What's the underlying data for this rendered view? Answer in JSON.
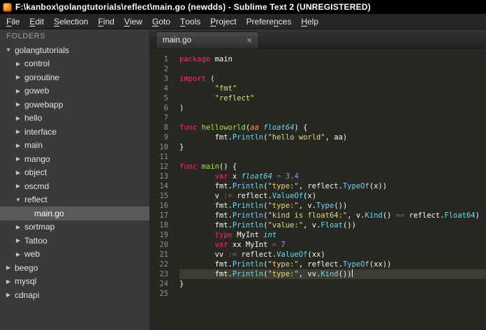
{
  "window": {
    "title": "F:\\kanbox\\golangtutorials\\reflect\\main.go (newdds) - Sublime Text 2 (UNREGISTERED)"
  },
  "menu": {
    "items": [
      {
        "pre": "",
        "key": "F",
        "post": "ile"
      },
      {
        "pre": "",
        "key": "E",
        "post": "dit"
      },
      {
        "pre": "",
        "key": "S",
        "post": "election"
      },
      {
        "pre": "",
        "key": "F",
        "post": "ind"
      },
      {
        "pre": "",
        "key": "V",
        "post": "iew"
      },
      {
        "pre": "",
        "key": "G",
        "post": "oto"
      },
      {
        "pre": "",
        "key": "T",
        "post": "ools"
      },
      {
        "pre": "",
        "key": "P",
        "post": "roject"
      },
      {
        "pre": "Prefere",
        "key": "n",
        "post": "ces"
      },
      {
        "pre": "",
        "key": "H",
        "post": "elp"
      }
    ]
  },
  "sidebar": {
    "header": "FOLDERS",
    "icons": {
      "collapsed": "▶",
      "expanded": "▼"
    },
    "items": [
      {
        "label": "golangtutorials",
        "level": 0,
        "kind": "expanded",
        "selected": false
      },
      {
        "label": "control",
        "level": 1,
        "kind": "collapsed",
        "selected": false
      },
      {
        "label": "goroutine",
        "level": 1,
        "kind": "collapsed",
        "selected": false
      },
      {
        "label": "goweb",
        "level": 1,
        "kind": "collapsed",
        "selected": false
      },
      {
        "label": "gowebapp",
        "level": 1,
        "kind": "collapsed",
        "selected": false
      },
      {
        "label": "hello",
        "level": 1,
        "kind": "collapsed",
        "selected": false
      },
      {
        "label": "interface",
        "level": 1,
        "kind": "collapsed",
        "selected": false
      },
      {
        "label": "main",
        "level": 1,
        "kind": "collapsed",
        "selected": false
      },
      {
        "label": "mango",
        "level": 1,
        "kind": "collapsed",
        "selected": false
      },
      {
        "label": "object",
        "level": 1,
        "kind": "collapsed",
        "selected": false
      },
      {
        "label": "oscmd",
        "level": 1,
        "kind": "collapsed",
        "selected": false
      },
      {
        "label": "reflect",
        "level": 1,
        "kind": "expanded",
        "selected": false
      },
      {
        "label": "main.go",
        "level": 2,
        "kind": "file",
        "selected": true
      },
      {
        "label": "sortmap",
        "level": 1,
        "kind": "collapsed",
        "selected": false
      },
      {
        "label": "Tattoo",
        "level": 1,
        "kind": "collapsed",
        "selected": false
      },
      {
        "label": "web",
        "level": 1,
        "kind": "collapsed",
        "selected": false
      },
      {
        "label": "beego",
        "level": 0,
        "kind": "collapsed",
        "selected": false
      },
      {
        "label": "mysql",
        "level": 0,
        "kind": "collapsed",
        "selected": false
      },
      {
        "label": "cdnapi",
        "level": 0,
        "kind": "collapsed",
        "selected": false
      }
    ]
  },
  "tabs": [
    {
      "label": "main.go",
      "close_glyph": "×",
      "active": true
    }
  ],
  "editor": {
    "palette": {
      "background": "#272822",
      "plain": "#f8f8f2",
      "keyword": "#f92672",
      "string": "#e6db74",
      "function_name": "#a6e22e",
      "call": "#66d9ef",
      "type": "#66d9ef",
      "number": "#ae81ff",
      "parameter": "#fd971f",
      "gutter": "#8f908a",
      "current_line": "#3e3d32"
    },
    "lines": [
      {
        "n": 1,
        "segs": [
          [
            "k",
            "package"
          ],
          [
            "p",
            " main"
          ]
        ]
      },
      {
        "n": 2,
        "segs": []
      },
      {
        "n": 3,
        "segs": [
          [
            "k",
            "import"
          ],
          [
            "p",
            " ("
          ]
        ]
      },
      {
        "n": 4,
        "segs": [
          [
            "p",
            "        "
          ],
          [
            "s",
            "\"fmt\""
          ]
        ]
      },
      {
        "n": 5,
        "segs": [
          [
            "p",
            "        "
          ],
          [
            "s",
            "\"reflect\""
          ]
        ]
      },
      {
        "n": 6,
        "segs": [
          [
            "p",
            ")"
          ]
        ]
      },
      {
        "n": 7,
        "segs": []
      },
      {
        "n": 8,
        "segs": [
          [
            "k",
            "func"
          ],
          [
            "p",
            " "
          ],
          [
            "f",
            "helloworld"
          ],
          [
            "p",
            "("
          ],
          [
            "a",
            "aa"
          ],
          [
            "p",
            " "
          ],
          [
            "t",
            "float64"
          ],
          [
            "p",
            ") {"
          ]
        ]
      },
      {
        "n": 9,
        "segs": [
          [
            "p",
            "        fmt."
          ],
          [
            "c",
            "Println"
          ],
          [
            "p",
            "("
          ],
          [
            "s",
            "\"hello world\""
          ],
          [
            "p",
            ", aa)"
          ]
        ]
      },
      {
        "n": 10,
        "segs": [
          [
            "p",
            "}"
          ]
        ]
      },
      {
        "n": 11,
        "segs": []
      },
      {
        "n": 12,
        "segs": [
          [
            "k",
            "func"
          ],
          [
            "p",
            " "
          ],
          [
            "f",
            "main"
          ],
          [
            "p",
            "() {"
          ]
        ]
      },
      {
        "n": 13,
        "segs": [
          [
            "p",
            "        "
          ],
          [
            "k",
            "var"
          ],
          [
            "p",
            " x "
          ],
          [
            "t",
            "float64"
          ],
          [
            "p",
            " "
          ],
          [
            "k",
            "="
          ],
          [
            "p",
            " "
          ],
          [
            "n",
            "3.4"
          ]
        ]
      },
      {
        "n": 14,
        "segs": [
          [
            "p",
            "        fmt."
          ],
          [
            "c",
            "Println"
          ],
          [
            "p",
            "("
          ],
          [
            "s",
            "\"type:\""
          ],
          [
            "p",
            ", reflect."
          ],
          [
            "c",
            "TypeOf"
          ],
          [
            "p",
            "(x))"
          ]
        ]
      },
      {
        "n": 15,
        "segs": [
          [
            "p",
            "        v "
          ],
          [
            "k",
            ":="
          ],
          [
            "p",
            " reflect."
          ],
          [
            "c",
            "ValueOf"
          ],
          [
            "p",
            "(x)"
          ]
        ]
      },
      {
        "n": 16,
        "segs": [
          [
            "p",
            "        fmt."
          ],
          [
            "c",
            "Println"
          ],
          [
            "p",
            "("
          ],
          [
            "s",
            "\"type:\""
          ],
          [
            "p",
            ", v."
          ],
          [
            "c",
            "Type"
          ],
          [
            "p",
            "())"
          ]
        ]
      },
      {
        "n": 17,
        "segs": [
          [
            "p",
            "        fmt."
          ],
          [
            "c",
            "Println"
          ],
          [
            "p",
            "("
          ],
          [
            "s",
            "\"kind is float64:\""
          ],
          [
            "p",
            ", v."
          ],
          [
            "c",
            "Kind"
          ],
          [
            "p",
            "() "
          ],
          [
            "k",
            "=="
          ],
          [
            "p",
            " reflect."
          ],
          [
            "c",
            "Float64"
          ],
          [
            "p",
            ")"
          ]
        ]
      },
      {
        "n": 18,
        "segs": [
          [
            "p",
            "        fmt."
          ],
          [
            "c",
            "Println"
          ],
          [
            "p",
            "("
          ],
          [
            "s",
            "\"value:\""
          ],
          [
            "p",
            ", v."
          ],
          [
            "c",
            "Float"
          ],
          [
            "p",
            "())"
          ]
        ]
      },
      {
        "n": 19,
        "segs": [
          [
            "p",
            "        "
          ],
          [
            "k",
            "type"
          ],
          [
            "p",
            " MyInt "
          ],
          [
            "t",
            "int"
          ]
        ]
      },
      {
        "n": 20,
        "segs": [
          [
            "p",
            "        "
          ],
          [
            "k",
            "var"
          ],
          [
            "p",
            " xx MyInt "
          ],
          [
            "k",
            "="
          ],
          [
            "p",
            " "
          ],
          [
            "n",
            "7"
          ]
        ]
      },
      {
        "n": 21,
        "segs": [
          [
            "p",
            "        vv "
          ],
          [
            "k",
            ":="
          ],
          [
            "p",
            " reflect."
          ],
          [
            "c",
            "ValueOf"
          ],
          [
            "p",
            "(xx)"
          ]
        ]
      },
      {
        "n": 22,
        "segs": [
          [
            "p",
            "        fmt."
          ],
          [
            "c",
            "Println"
          ],
          [
            "p",
            "("
          ],
          [
            "s",
            "\"type:\""
          ],
          [
            "p",
            ", reflect."
          ],
          [
            "c",
            "TypeOf"
          ],
          [
            "p",
            "(xx))"
          ]
        ]
      },
      {
        "n": 23,
        "current": true,
        "caret": true,
        "segs": [
          [
            "p",
            "        fmt."
          ],
          [
            "c",
            "Println"
          ],
          [
            "p",
            "("
          ],
          [
            "s",
            "\"type:\""
          ],
          [
            "p",
            ", vv."
          ],
          [
            "c",
            "Kind"
          ],
          [
            "p",
            "())"
          ]
        ]
      },
      {
        "n": 24,
        "segs": [
          [
            "p",
            "}"
          ]
        ]
      },
      {
        "n": 25,
        "segs": []
      }
    ]
  }
}
